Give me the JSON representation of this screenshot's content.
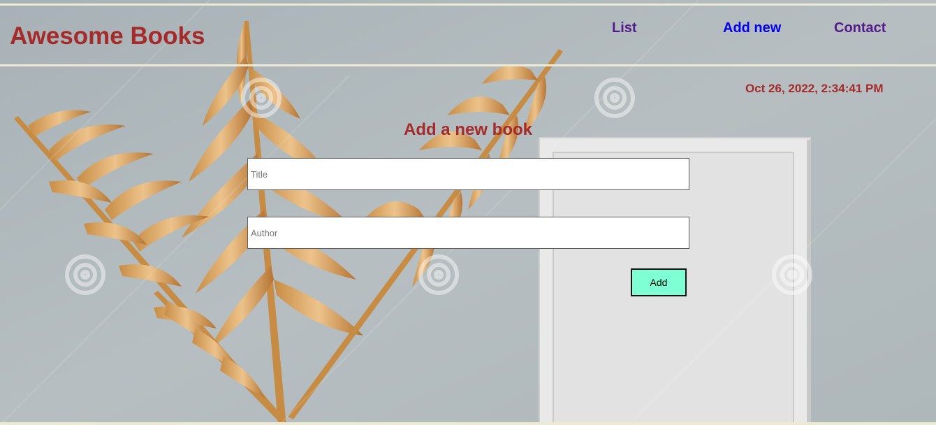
{
  "brand": {
    "title": "Awesome Books"
  },
  "nav": {
    "list": "List",
    "add_new": "Add new",
    "contact": "Contact",
    "active": "add_new"
  },
  "datetime": "Oct 26, 2022, 2:34:41 PM",
  "form": {
    "heading": "Add a new book",
    "title_placeholder": "Title",
    "author_placeholder": "Author",
    "title_value": "",
    "author_value": "",
    "add_label": "Add"
  },
  "colors": {
    "brand": "#a52a2a",
    "nav_visited": "#551a8b",
    "nav_active": "#0000ee",
    "button": "#7fffd4",
    "rule": "#ece9d4"
  },
  "icons": [
    "palm-leaf-illustration",
    "picture-frame-illustration",
    "watermark-spiral-icon"
  ]
}
